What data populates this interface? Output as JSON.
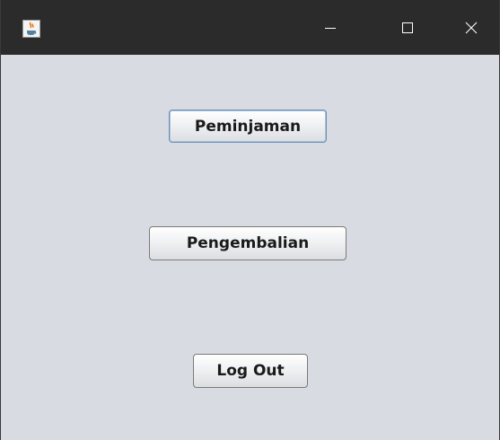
{
  "window": {
    "title": ""
  },
  "titlebar": {
    "app_icon": "java-coffee-icon",
    "controls": {
      "minimize_icon": "minimize-icon",
      "maximize_icon": "maximize-icon",
      "close_icon": "close-icon"
    }
  },
  "main": {
    "peminjaman_label": "Peminjaman",
    "pengembalian_label": "Pengembalian",
    "logout_label": "Log Out"
  },
  "colors": {
    "titlebar": "#2b2b2b",
    "panel_background": "#d8dbe1",
    "focus_border": "#6d8fb5"
  }
}
